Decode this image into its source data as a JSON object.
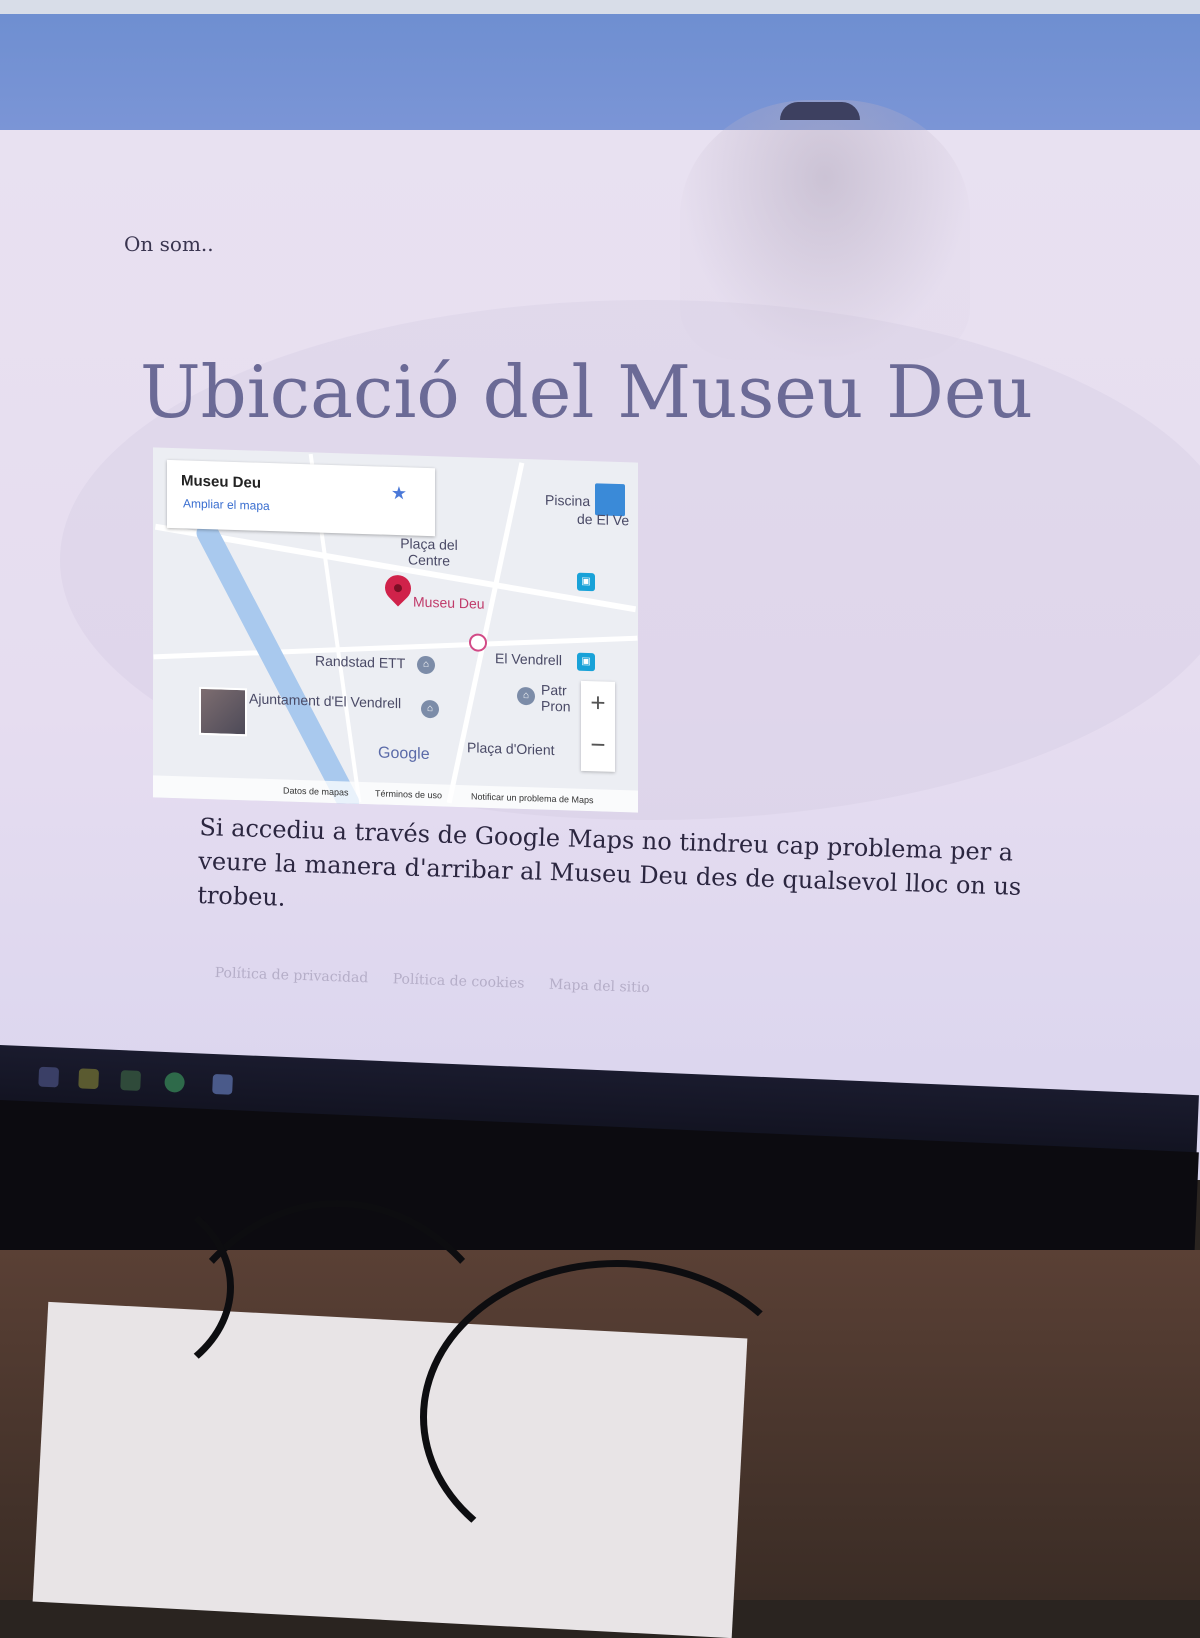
{
  "page": {
    "eyebrow": "On som..",
    "title": "Ubicació del Museu Deu",
    "body_text": "Si accediu a través de Google Maps no tindreu cap problema per a veure la manera d'arribar al Museu Deu des de qualsevol lloc on us trobeu."
  },
  "map": {
    "place_name": "Museu Deu",
    "enlarge_link": "Ampliar el mapa",
    "labels": {
      "placa_centre": "Plaça del Centre",
      "museu": "Museu Deu",
      "randstad": "Randstad ETT",
      "el_vendrell": "El Vendrell",
      "ajuntament": "Ajuntament d'El Vendrell",
      "placa_orient": "Plaça d'Orient",
      "piscina": "Piscina",
      "piscina_sub": "de El Ve",
      "patronat": "Patr",
      "patronat_sub": "Pron",
      "google": "Google"
    },
    "zoom_in": "+",
    "zoom_out": "−",
    "footer": {
      "map_data": "Datos de mapas",
      "terms": "Términos de uso",
      "report": "Notificar un problema de Maps"
    }
  },
  "footer": {
    "links": [
      "Política de privacidad",
      "Política de cookies",
      "Mapa del sitio"
    ]
  },
  "colors": {
    "title": "#6b6a96",
    "body_text": "#2b2640",
    "pin": "#d0224a",
    "header_band": "#6d8ed0"
  }
}
